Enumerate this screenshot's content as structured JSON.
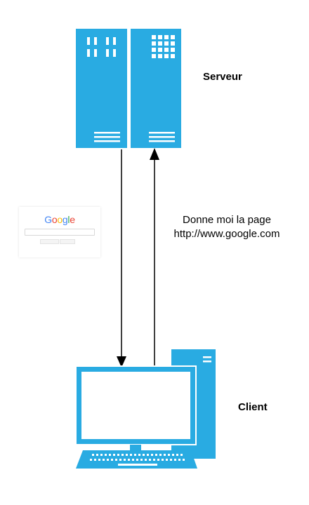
{
  "labels": {
    "server": "Serveur",
    "client": "Client",
    "request_line1": "Donne moi la page",
    "request_line2": "http://www.google.com"
  },
  "thumbnail": {
    "logo_text": [
      "G",
      "o",
      "o",
      "g",
      "l",
      "e"
    ],
    "logo_colors": [
      "#4285F4",
      "#EA4335",
      "#FBBC05",
      "#4285F4",
      "#34A853",
      "#EA4335"
    ]
  },
  "colors": {
    "accent": "#29ABE2",
    "arrow": "#000000"
  },
  "icons": {
    "server": "server-rack-icon",
    "client": "desktop-computer-icon",
    "request": "arrow-up",
    "response": "arrow-down"
  }
}
